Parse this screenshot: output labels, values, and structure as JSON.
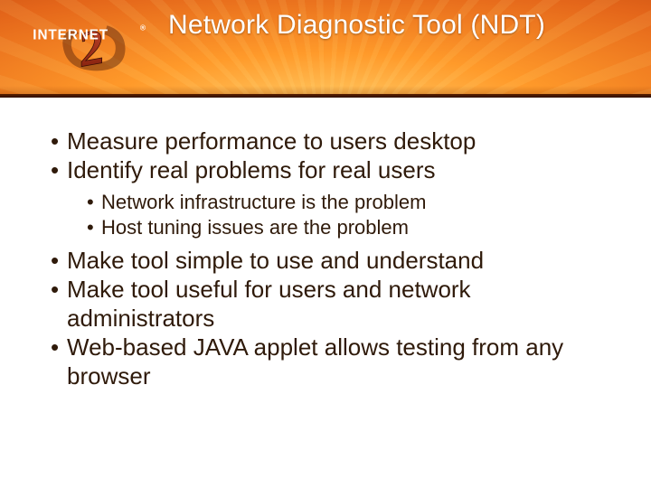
{
  "brand": {
    "name": "INTERNET",
    "registered": "®",
    "logo_fill": "#a2241a",
    "logo_shadow": "#3b0f05",
    "logo_text_fill": "#ffffff"
  },
  "title": "Network Diagnostic Tool (NDT)",
  "bullets": {
    "a1": "Measure performance to users desktop",
    "a2": "Identify real problems for real users",
    "a2_sub1": "Network infrastructure is the problem",
    "a2_sub2": "Host tuning issues are the problem",
    "a3": "Make tool simple to use and understand",
    "a4": "Make tool useful for users and network administrators",
    "a5": "Web-based JAVA applet allows testing from any browser"
  }
}
